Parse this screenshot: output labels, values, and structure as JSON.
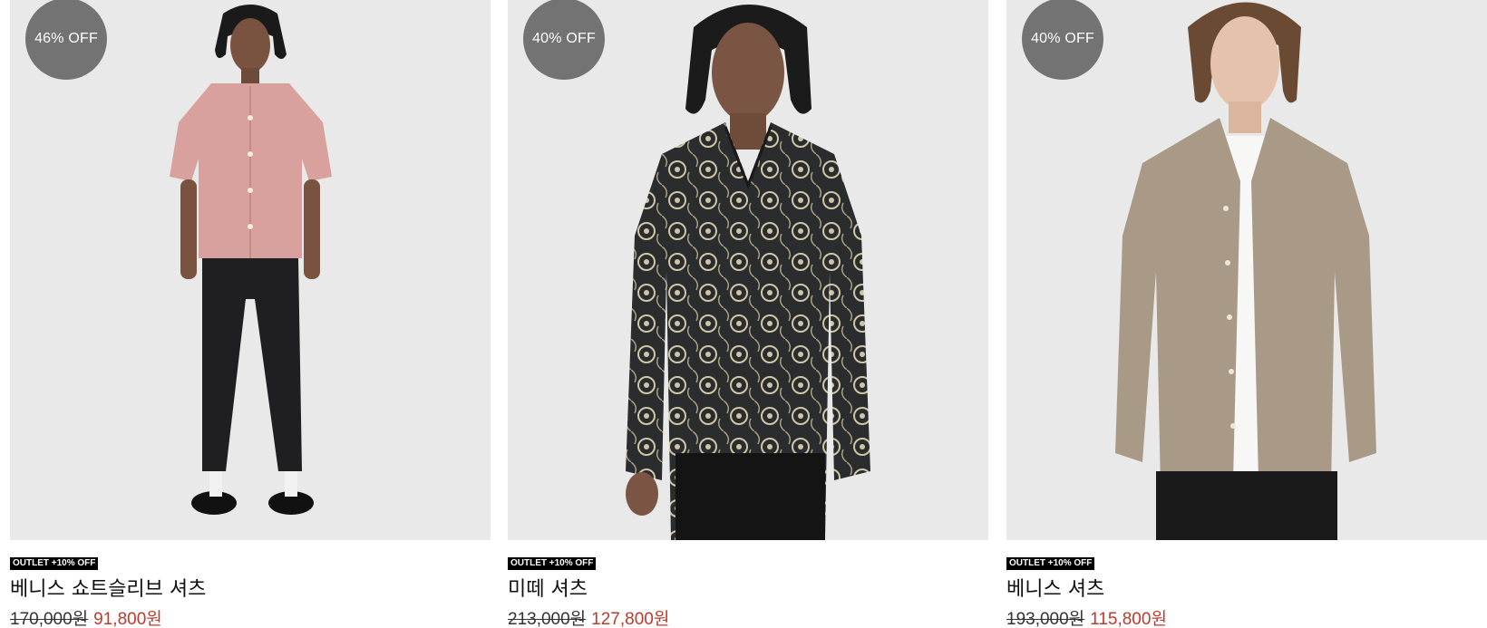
{
  "products": [
    {
      "badge": "46% OFF",
      "tag": "OUTLET +10% OFF",
      "name": "베니스 쇼트슬리브 셔츠",
      "original_price": "170,000원",
      "sale_price": "91,800원",
      "shirt_color": "#d9a19d"
    },
    {
      "badge": "40% OFF",
      "tag": "OUTLET +10% OFF",
      "name": "미떼 셔츠",
      "original_price": "213,000원",
      "sale_price": "127,800원",
      "shirt_color": "#2b2c2e"
    },
    {
      "badge": "40% OFF",
      "tag": "OUTLET +10% OFF",
      "name": "베니스 셔츠",
      "original_price": "193,000원",
      "sale_price": "115,800원",
      "shirt_color": "#a89a87"
    }
  ],
  "colors": {
    "badge_bg": "#737373",
    "tag_bg": "#000000",
    "sale_price": "#c0392b",
    "photo_bg": "#e8e8e8"
  }
}
